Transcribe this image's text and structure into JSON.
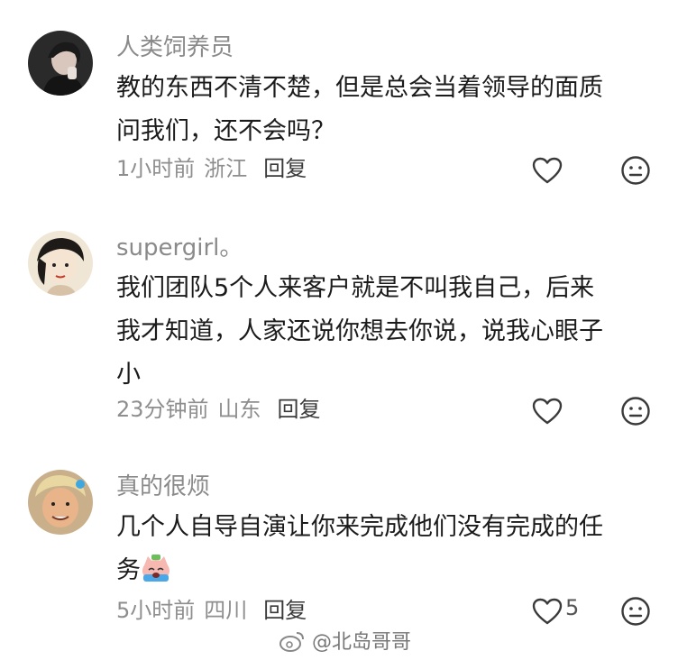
{
  "comments": [
    {
      "username": "人类饲养员",
      "lines": [
        "教的东西不清不楚，但是总会当着领导的面质",
        "问我们，还不会吗？"
      ],
      "time": "1小时前",
      "location": "浙江",
      "reply_label": "回复",
      "like_count": ""
    },
    {
      "username": "supergirl。",
      "lines": [
        "我们团队5个人来客户就是不叫我自己，后来",
        "我才知道，人家还说你想去你说，说我心眼子",
        "小"
      ],
      "time": "23分钟前",
      "location": "山东",
      "reply_label": "回复",
      "like_count": ""
    },
    {
      "username": "真的很烦",
      "lines": [
        "几个人自导自演让你来完成他们没有完成的任",
        "务"
      ],
      "time": "5小时前",
      "location": "四川",
      "reply_label": "回复",
      "like_count": "5"
    }
  ],
  "watermark": "@北岛哥哥",
  "icons": {
    "like": "heart-outline-icon",
    "dislike": "neutral-face-icon",
    "emoji": "crying-cat-emoji"
  },
  "colors": {
    "username": "#8a8a8a",
    "text": "#1b1b1b",
    "meta": "#8e8e8e"
  }
}
